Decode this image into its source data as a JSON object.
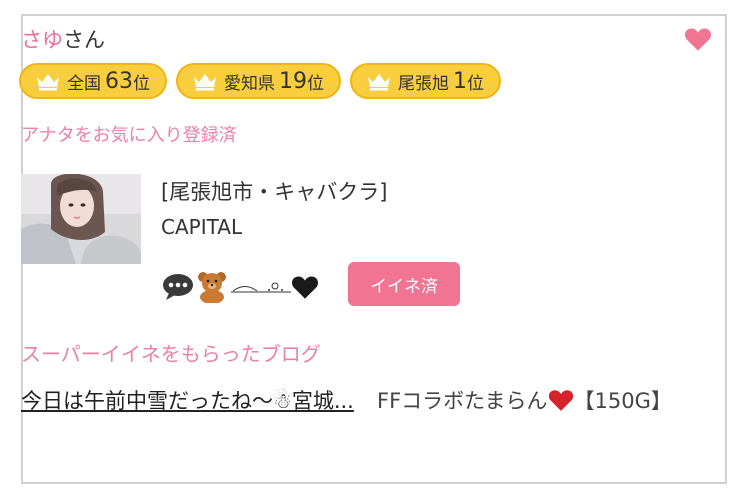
{
  "profile": {
    "name_highlight": "さゆ",
    "name_suffix": "さん",
    "favorite_status": "アナタをお気に入り登録済"
  },
  "rankings": [
    {
      "region": "全国",
      "rank": "63",
      "unit": "位"
    },
    {
      "region": "愛知県",
      "rank": "19",
      "unit": "位"
    },
    {
      "region": "尾張旭",
      "rank": "1",
      "unit": "位"
    }
  ],
  "shop": {
    "category": "[尾張旭市・キャバクラ]",
    "name": "CAPITAL"
  },
  "like_button": "イイネ済",
  "blog": {
    "heading": "スーパーイイネをもらったブログ",
    "post1_title": "今日は午前中雪だったね〜☃宮城...",
    "post2_title_a": "FFコラボたまらん",
    "post2_title_b": "【150G】"
  },
  "icons": {
    "heart": "heart-icon",
    "crown": "crown-icon",
    "speech": "speech-bubble-icon",
    "bear": "teddy-bear-icon",
    "black_heart": "black-heart-icon",
    "red_heart": "red-heart-icon",
    "snowman": "snowman-icon"
  },
  "colors": {
    "accent_pink": "#ec80a8",
    "badge_yellow": "#f9ce3e",
    "button_pink": "#f17593"
  }
}
